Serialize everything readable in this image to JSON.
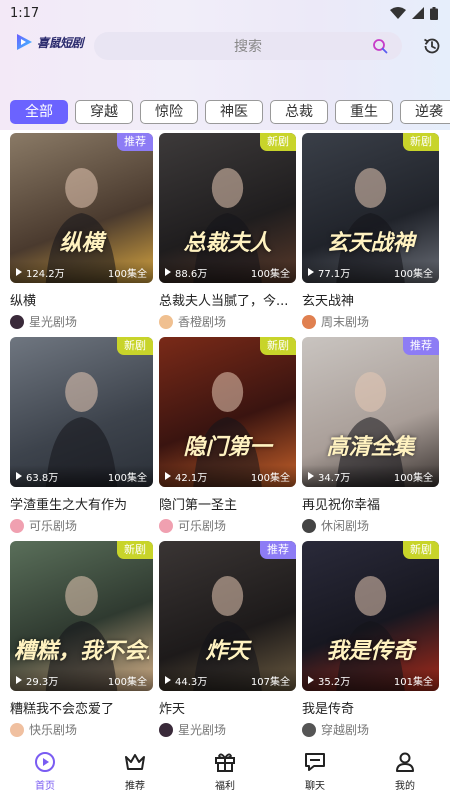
{
  "status_bar": {
    "time": "1:17"
  },
  "header": {
    "logo_text": "喜鼠短剧",
    "search_placeholder": "搜索",
    "history_icon": "history-icon"
  },
  "tabs": [
    "全部",
    "穿越",
    "惊险",
    "神医",
    "总裁",
    "重生",
    "逆袭"
  ],
  "active_tab": 0,
  "colors": {
    "accent": "#6b63ff",
    "new_badge": "#c8d42a",
    "rec_badge": "#8d7cf5"
  },
  "dramas": [
    {
      "title": "纵横",
      "badge": "推荐",
      "views": "124.2万",
      "episodes": "100集全",
      "overlay": "纵横",
      "source": "星光剧场"
    },
    {
      "title": "总裁夫人当腻了，今...",
      "badge": "新剧",
      "views": "88.6万",
      "episodes": "100集全",
      "overlay": "总裁夫人",
      "source": "香橙剧场"
    },
    {
      "title": "玄天战神",
      "badge": "新剧",
      "views": "77.1万",
      "episodes": "100集全",
      "overlay": "玄天战神",
      "source": "周末剧场"
    },
    {
      "title": "学渣重生之大有作为",
      "badge": "新剧",
      "views": "63.8万",
      "episodes": "100集全",
      "overlay": "",
      "source": "可乐剧场"
    },
    {
      "title": "隐门第一圣主",
      "badge": "新剧",
      "views": "42.1万",
      "episodes": "100集全",
      "overlay": "隐门第一",
      "source": "可乐剧场"
    },
    {
      "title": "再见祝你幸福",
      "badge": "推荐",
      "views": "34.7万",
      "episodes": "100集全",
      "overlay": "高清全集",
      "source": "休闲剧场"
    },
    {
      "title": "糟糕我不会恋爱了",
      "badge": "新剧",
      "views": "29.3万",
      "episodes": "100集全",
      "overlay": "糟糕，我不会恋爱了",
      "source": "快乐剧场"
    },
    {
      "title": "炸天",
      "badge": "推荐",
      "views": "44.3万",
      "episodes": "107集全",
      "overlay": "炸天",
      "source": "星光剧场"
    },
    {
      "title": "我是传奇",
      "badge": "新剧",
      "views": "35.2万",
      "episodes": "101集全",
      "overlay": "我是传奇",
      "source": "穿越剧场"
    }
  ],
  "nav": [
    {
      "label": "首页",
      "icon": "home-play-icon"
    },
    {
      "label": "推荐",
      "icon": "crown-icon"
    },
    {
      "label": "福利",
      "icon": "gift-icon"
    },
    {
      "label": "聊天",
      "icon": "chat-icon"
    },
    {
      "label": "我的",
      "icon": "profile-icon"
    }
  ],
  "active_nav": 0
}
